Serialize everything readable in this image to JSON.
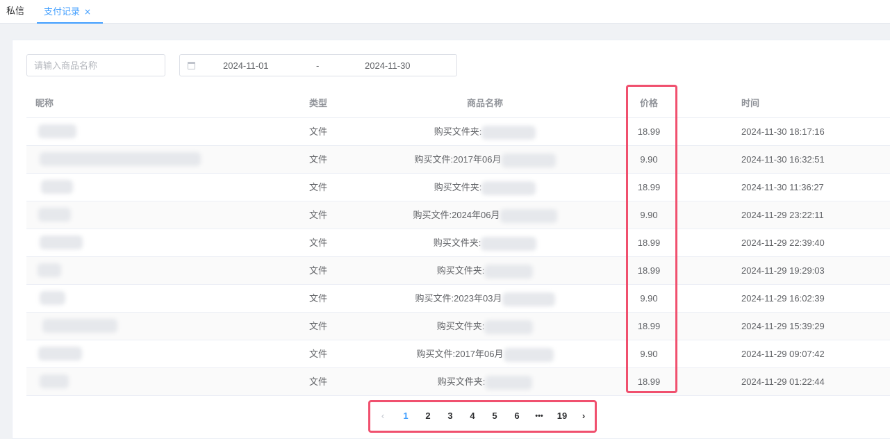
{
  "tabs": [
    {
      "label": "私信"
    },
    {
      "label": "支付记录",
      "close": "×"
    }
  ],
  "filters": {
    "search_placeholder": "请输入商品名称",
    "start_date": "2024-11-01",
    "separator": "-",
    "end_date": "2024-11-30"
  },
  "table": {
    "headers": {
      "nickname": "昵称",
      "type": "类型",
      "product": "商品名称",
      "price": "价格",
      "time": "时间"
    },
    "rows": [
      {
        "type": "文件",
        "product": "购买文件夹:",
        "price": "18.99",
        "time": "2024-11-30 18:17:16"
      },
      {
        "type": "文件",
        "product": "购买文件:2017年06月",
        "price": "9.90",
        "time": "2024-11-30 16:32:51"
      },
      {
        "type": "文件",
        "product": "购买文件夹:",
        "price": "18.99",
        "time": "2024-11-30 11:36:27"
      },
      {
        "type": "文件",
        "product": "购买文件:2024年06月",
        "price": "9.90",
        "time": "2024-11-29 23:22:11"
      },
      {
        "type": "文件",
        "product": "购买文件夹:",
        "price": "18.99",
        "time": "2024-11-29 22:39:40"
      },
      {
        "type": "文件",
        "product": "购买文件夹:",
        "price": "18.99",
        "time": "2024-11-29 19:29:03"
      },
      {
        "type": "文件",
        "product": "购买文件:2023年03月",
        "price": "9.90",
        "time": "2024-11-29 16:02:39"
      },
      {
        "type": "文件",
        "product": "购买文件夹:",
        "price": "18.99",
        "time": "2024-11-29 15:39:29"
      },
      {
        "type": "文件",
        "product": "购买文件:2017年06月",
        "price": "9.90",
        "time": "2024-11-29 09:07:42"
      },
      {
        "type": "文件",
        "product": "购买文件夹:",
        "price": "18.99",
        "time": "2024-11-29 01:22:44"
      }
    ]
  },
  "pagination": {
    "prev": "‹",
    "pages": [
      "1",
      "2",
      "3",
      "4",
      "5",
      "6"
    ],
    "ellipsis": "•••",
    "last": "19",
    "next": "›",
    "current": "1"
  },
  "colors": {
    "accent": "#409eff",
    "highlight": "#f0506e"
  }
}
